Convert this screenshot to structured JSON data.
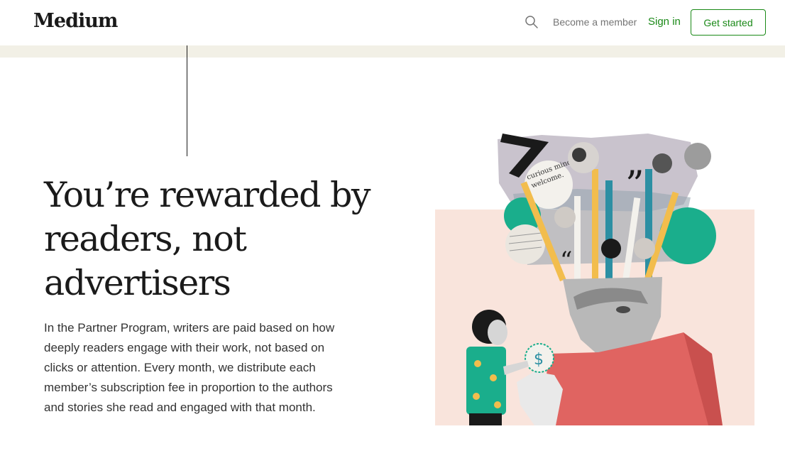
{
  "header": {
    "logo": "Medium",
    "search_icon": "search-icon",
    "become_member": "Become a member",
    "sign_in": "Sign in",
    "get_started": "Get started"
  },
  "hero": {
    "headline_lines": [
      "You’re rewarded by",
      "readers, not",
      "advertisers"
    ],
    "body_lines": [
      "In the Partner Program, writers are paid based on how",
      "deeply readers engage with their work, not based on",
      "clicks or attention. Every month, we distribute each",
      "member’s subscription fee in proportion to the authors",
      "and stories she read and engaged with that month."
    ]
  },
  "illustration": {
    "collage_text": [
      "curious minds",
      "welcome."
    ],
    "colors": {
      "panel": "#f9e4dc",
      "teal": "#1aae8c",
      "blue_bar": "#2c8fa3",
      "yellow_bar": "#f2bd4d",
      "shirt": "#e06461"
    }
  },
  "colors": {
    "accent": "#1a8917",
    "band": "#f2f0e6"
  }
}
